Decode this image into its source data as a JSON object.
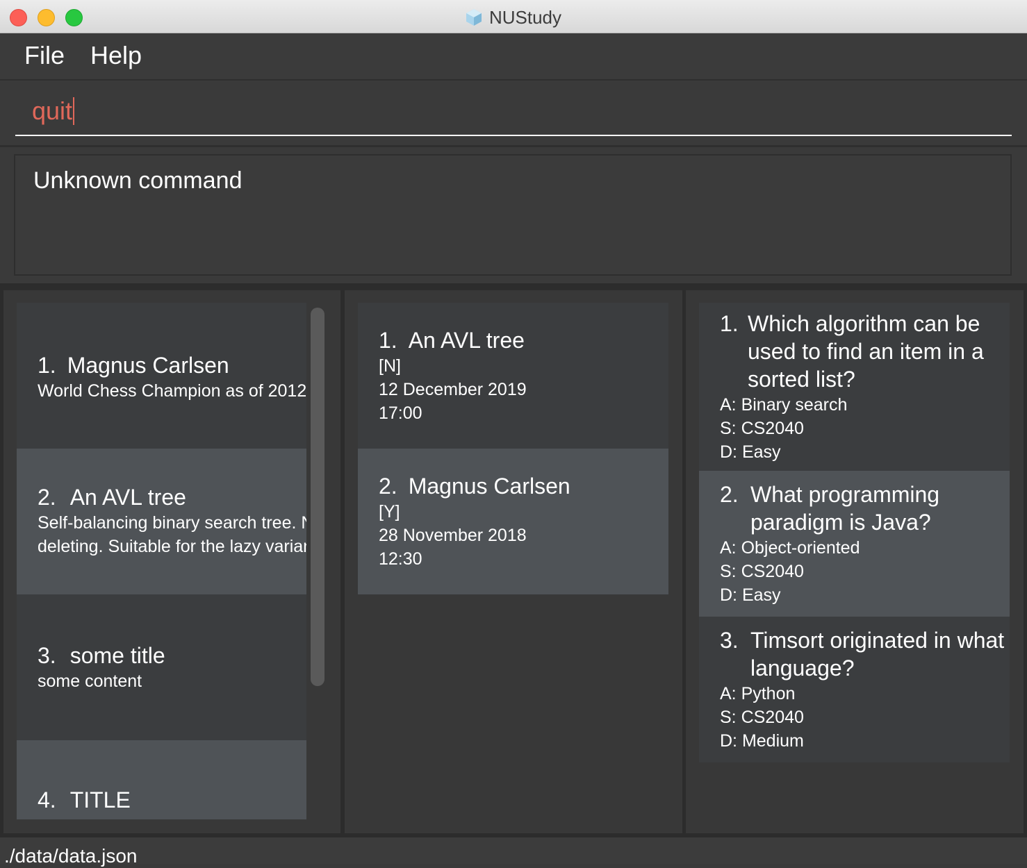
{
  "window": {
    "title": "NUStudy"
  },
  "menu": {
    "file": "File",
    "help": "Help"
  },
  "command": {
    "value": "quit"
  },
  "result": {
    "message": "Unknown command"
  },
  "notes": [
    {
      "index": "1.",
      "title": "Magnus Carlsen",
      "lines": [
        "World Chess Champion as of 2012"
      ]
    },
    {
      "index": "2.",
      "title": "An AVL tree",
      "lines": [
        "Self-balancing binary search tree. N",
        "deleting. Suitable for the lazy variant"
      ]
    },
    {
      "index": "3.",
      "title": "some title",
      "lines": [
        "some content"
      ]
    },
    {
      "index": "4.",
      "title": "TITLE",
      "lines": []
    }
  ],
  "reminders": [
    {
      "index": "1.",
      "title": "An AVL tree",
      "flag": "[N]",
      "date": "12 December 2019",
      "time": "17:00"
    },
    {
      "index": "2.",
      "title": "Magnus Carlsen",
      "flag": "[Y]",
      "date": "28 November 2018",
      "time": "12:30"
    }
  ],
  "questions": [
    {
      "index": "1.",
      "lines": [
        "Which algorithm can be",
        "used to find an item in a",
        "sorted list?"
      ],
      "answer": "A: Binary search",
      "subject": "S: CS2040",
      "difficulty": "D: Easy"
    },
    {
      "index": "2.",
      "lines": [
        "What programming",
        "paradigm is Java?"
      ],
      "answer": "A: Object-oriented",
      "subject": "S: CS2040",
      "difficulty": "D: Easy"
    },
    {
      "index": "3.",
      "lines": [
        "Timsort originated in what",
        "language?"
      ],
      "answer": "A: Python",
      "subject": "S: CS2040",
      "difficulty": "D: Medium"
    }
  ],
  "status": {
    "path": "./data/data.json"
  }
}
